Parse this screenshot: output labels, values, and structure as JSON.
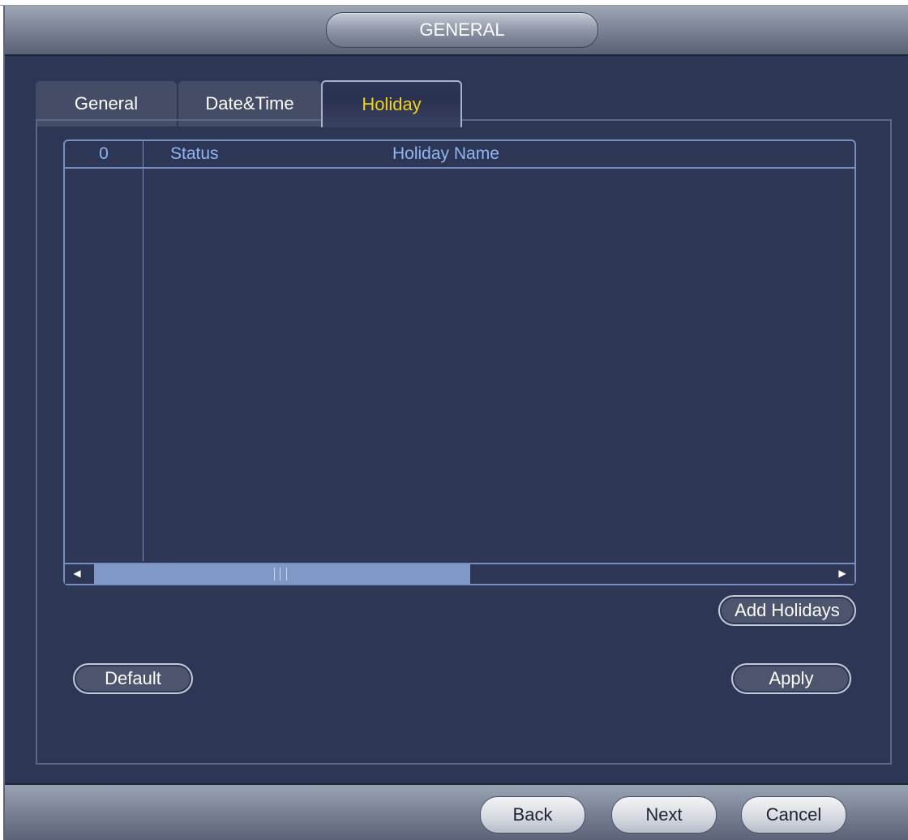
{
  "window": {
    "title": "GENERAL"
  },
  "tabs": [
    {
      "label": "General",
      "active": false
    },
    {
      "label": "Date&Time",
      "active": false
    },
    {
      "label": "Holiday",
      "active": true
    }
  ],
  "holiday_table": {
    "columns": [
      "0",
      "Status",
      "Holiday Name"
    ],
    "rows": []
  },
  "actions": {
    "add_holidays": "Add Holidays",
    "default": "Default",
    "apply": "Apply"
  },
  "footer": {
    "back": "Back",
    "next": "Next",
    "cancel": "Cancel"
  },
  "icons": {
    "scroll_left": "left-arrow-icon",
    "scroll_right": "right-arrow-icon"
  },
  "colors": {
    "active_tab_text": "#f1d21d",
    "header_text": "#8fb6f2",
    "background": "#2d3654"
  }
}
